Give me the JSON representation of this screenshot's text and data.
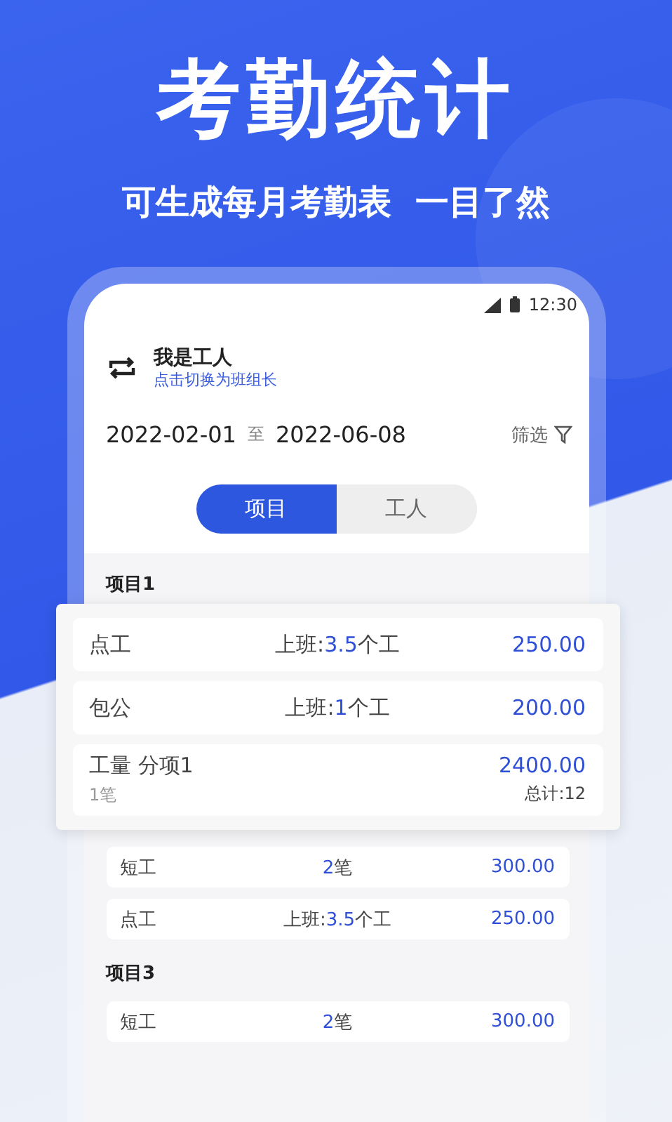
{
  "headline": "考勤统计",
  "subtitle": "可生成每月考勤表  一目了然",
  "status_bar": {
    "time": "12:30"
  },
  "role": {
    "title": "我是工人",
    "switch_link": "点击切换为班组长"
  },
  "date_range": {
    "start": "2022-02-01",
    "separator": "至",
    "end": "2022-06-08"
  },
  "filter": {
    "label": "筛选"
  },
  "tabs": [
    {
      "label": "项目",
      "selected": true
    },
    {
      "label": "工人",
      "selected": false
    }
  ],
  "groups": [
    {
      "title": "项目1",
      "raised": true,
      "rows": [
        {
          "kind": "simple",
          "name": "点工",
          "work": {
            "prefix": "上班:",
            "value": "3.5",
            "suffix": "个工"
          },
          "amount": "250.00"
        },
        {
          "kind": "simple",
          "name": "包公",
          "work": {
            "prefix": "上班:",
            "value": "1",
            "suffix": "个工"
          },
          "amount": "200.00"
        },
        {
          "kind": "detail",
          "name": "工量 分项1",
          "amount": "2400.00",
          "note": "1笔",
          "total": "总计:12"
        }
      ]
    },
    {
      "raised": false,
      "rows": [
        {
          "kind": "simple",
          "name": "短工",
          "work": {
            "value": "2",
            "suffix": "笔"
          },
          "amount": "300.00"
        },
        {
          "kind": "simple",
          "name": "点工",
          "work": {
            "prefix": "上班:",
            "value": "3.5",
            "suffix": "个工"
          },
          "amount": "250.00"
        }
      ]
    },
    {
      "title": "项目3",
      "raised": false,
      "rows": [
        {
          "kind": "simple",
          "name": "短工",
          "work": {
            "value": "2",
            "suffix": "笔"
          },
          "amount": "300.00"
        }
      ]
    }
  ]
}
